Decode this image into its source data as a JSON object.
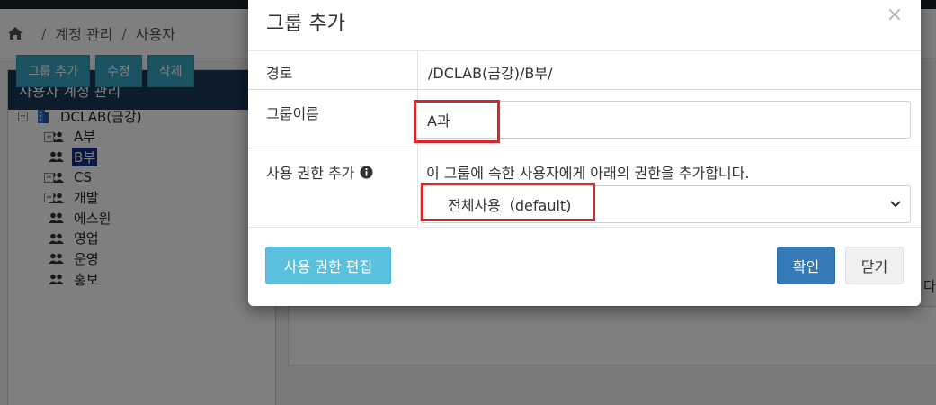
{
  "breadcrumb": {
    "icon": "home-icon",
    "items": [
      "계정 관리",
      "사용자"
    ],
    "separator": "/"
  },
  "panel": {
    "title": "사용자 계정 관리",
    "buttons": {
      "add_group": "그룹 추가",
      "edit": "수정",
      "delete": "삭제"
    }
  },
  "tree": {
    "root": "DCLAB(금강)",
    "children": [
      "A부",
      "B부",
      "CS",
      "개발",
      "에스원",
      "영업",
      "운영",
      "홍보"
    ],
    "selected": "B부"
  },
  "side_text": "다.",
  "modal": {
    "title": "그룹 추가",
    "close_symbol": "×",
    "path_label": "경로",
    "path_value": "/DCLAB(금강)/B부/",
    "name_label": "그룹이름",
    "name_value": "A과",
    "perm_label": "사용 권한 추가",
    "perm_desc": "이 그룹에 속한 사용자에게 아래의 권한을 추가합니다.",
    "perm_selected": "전체사용（default)",
    "buttons": {
      "edit_perm": "사용 권한 편집",
      "ok": "확인",
      "close": "닫기"
    }
  },
  "colors": {
    "topbar": "#1d2229",
    "panel_head": "#1b3954",
    "accent_button": "#36a7c6",
    "primary": "#337ab7",
    "info": "#5bc0de",
    "highlight": "#d9262c",
    "tree_selected": "#1b2e8a"
  }
}
